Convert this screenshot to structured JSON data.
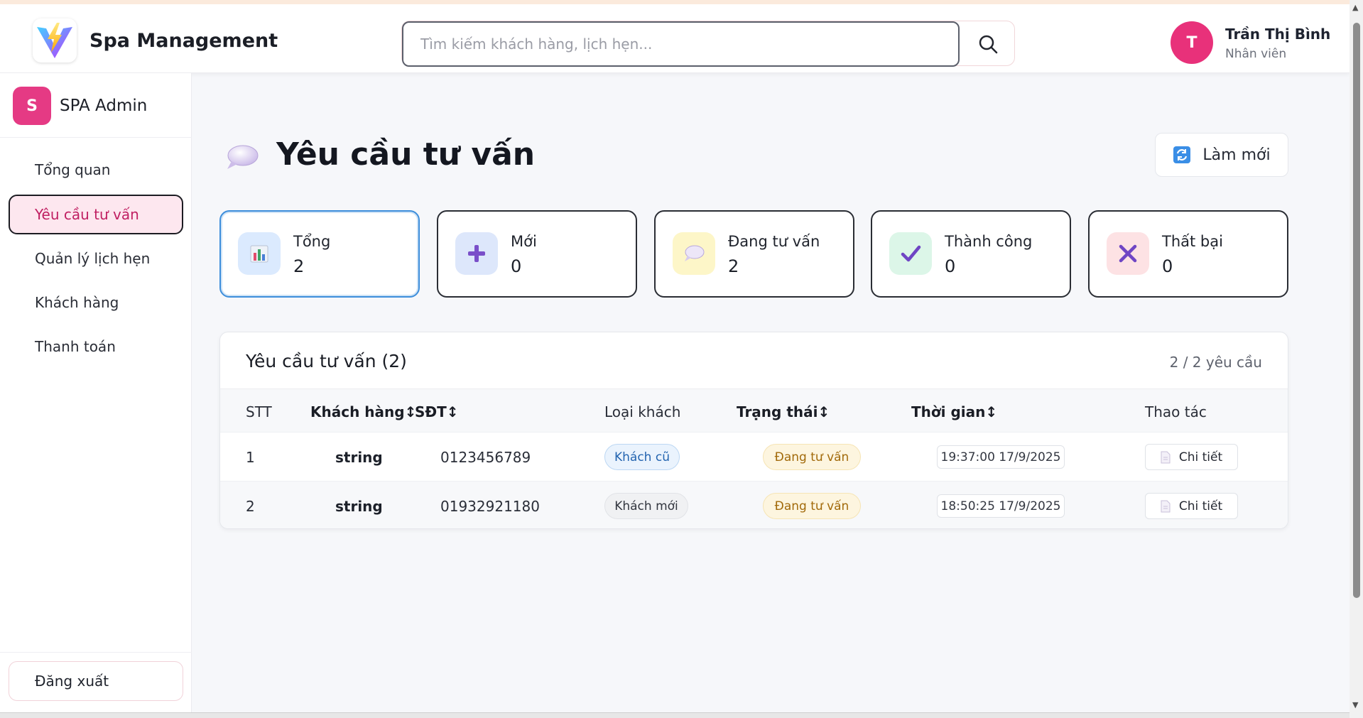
{
  "header": {
    "brand": "Spa Management",
    "search_placeholder": "Tìm kiếm khách hàng, lịch hẹn...",
    "user": {
      "initial": "T",
      "name": "Trần Thị Bình",
      "role": "Nhân viên"
    }
  },
  "sidebar": {
    "logo_initial": "S",
    "title": "SPA Admin",
    "items": [
      {
        "label": "Tổng quan",
        "active": false
      },
      {
        "label": "Yêu cầu tư vấn",
        "active": true
      },
      {
        "label": "Quản lý lịch hẹn",
        "active": false
      },
      {
        "label": "Khách hàng",
        "active": false
      },
      {
        "label": "Thanh toán",
        "active": false
      }
    ],
    "logout_label": "Đăng xuất"
  },
  "page": {
    "title": "Yêu cầu tư vấn",
    "refresh_label": "Làm mới"
  },
  "stats": [
    {
      "label": "Tổng",
      "value": "2",
      "icon": "bar-chart-icon",
      "color": "#dbeafe"
    },
    {
      "label": "Mới",
      "value": "0",
      "icon": "plus-icon",
      "color": "#dde7fb"
    },
    {
      "label": "Đang tư vấn",
      "value": "2",
      "icon": "speech-bubble-icon",
      "color": "#fdf6c8"
    },
    {
      "label": "Thành công",
      "value": "0",
      "icon": "check-icon",
      "color": "#dcf6e8"
    },
    {
      "label": "Thất bại",
      "value": "0",
      "icon": "x-icon",
      "color": "#fde2e4"
    }
  ],
  "table": {
    "title": "Yêu cầu tư vấn (2)",
    "count": "2 / 2 yêu cầu",
    "columns": [
      "STT",
      "Khách hàng↕",
      "SĐT↕",
      "Loại khách",
      "Trạng thái↕",
      "Thời gian↕",
      "Thao tác"
    ],
    "rows": [
      {
        "stt": "1",
        "customer": "string",
        "phone": "0123456789",
        "type": "Khách cũ",
        "status": "Đang tư vấn",
        "time": "19:37:00 17/9/2025",
        "action": "Chi tiết"
      },
      {
        "stt": "2",
        "customer": "string",
        "phone": "01932921180",
        "type": "Khách mới",
        "status": "Đang tư vấn",
        "time": "18:50:25 17/9/2025",
        "action": "Chi tiết"
      }
    ]
  }
}
